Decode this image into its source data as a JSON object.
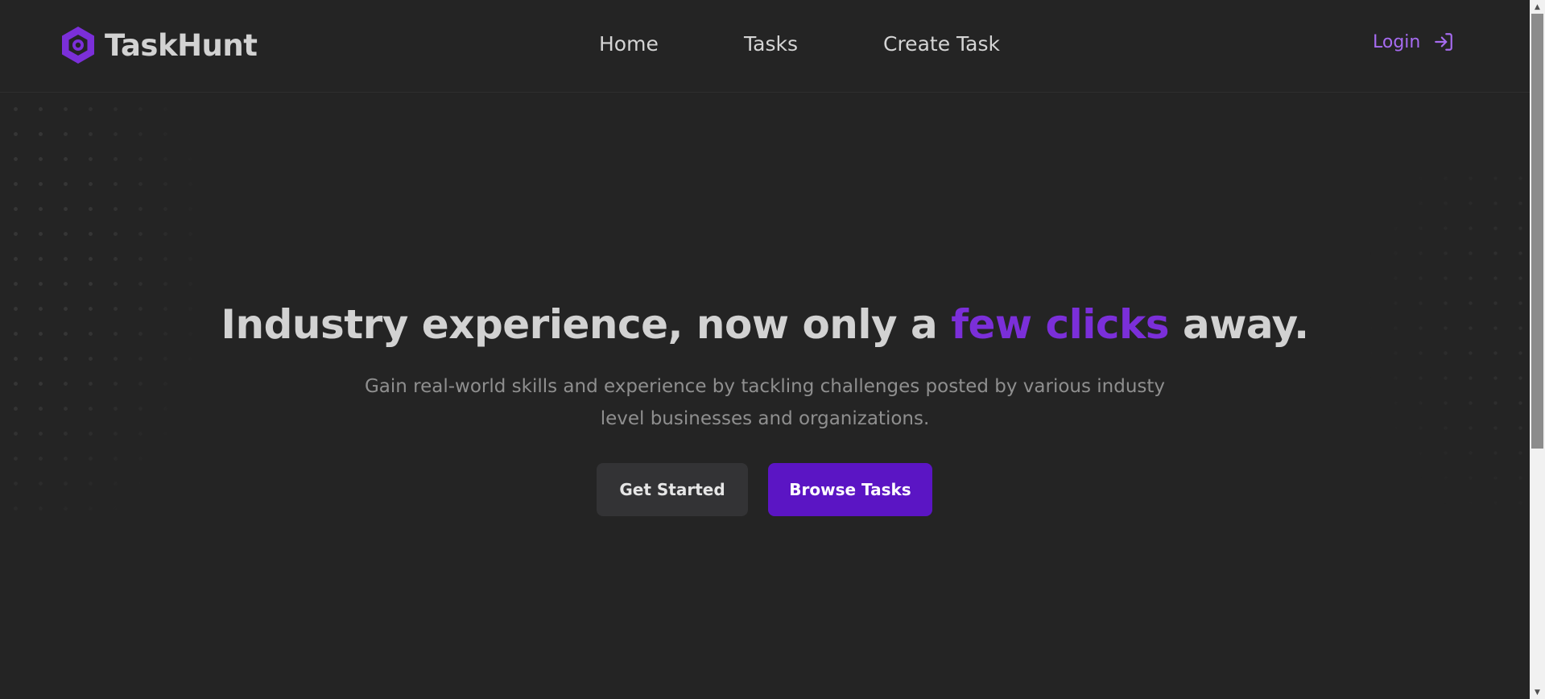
{
  "header": {
    "brand": "TaskHunt",
    "nav": {
      "home": "Home",
      "tasks": "Tasks",
      "create_task": "Create Task"
    },
    "login_label": "Login"
  },
  "hero": {
    "title_start": "Industry experience, now only a ",
    "title_accent": "few clicks",
    "title_end": " away.",
    "subtitle": "Gain real-world skills and experience by tackling challenges posted by various industy level businesses and organizations.",
    "primary_button": "Browse Tasks",
    "secondary_button": "Get Started"
  },
  "colors": {
    "background": "#242424",
    "accent": "#7b2fd9",
    "button_primary": "#5b15c4",
    "login": "#a66bf0"
  },
  "icons": {
    "logo": "hexagon-logo-icon",
    "login": "login-arrow-icon"
  }
}
